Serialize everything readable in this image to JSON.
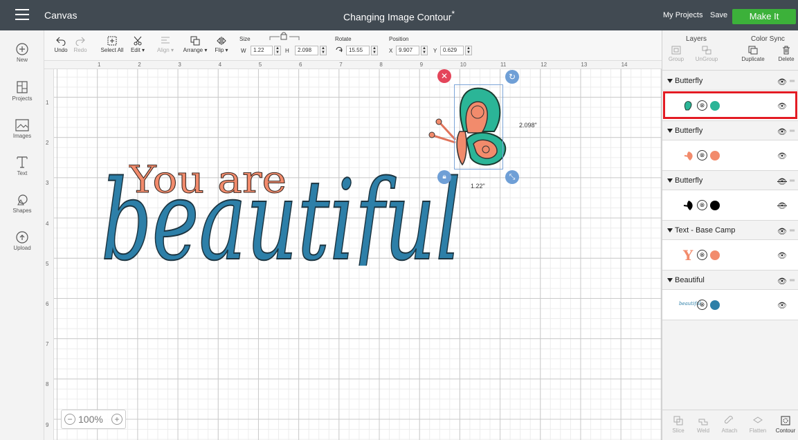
{
  "app": {
    "title": "Canvas",
    "project_title": "Changing Image Contour",
    "modified_mark": "*"
  },
  "header": {
    "my_projects": "My Projects",
    "save": "Save",
    "make_it": "Make It"
  },
  "left_tools": [
    {
      "label": "New",
      "icon": "plus-circle-icon"
    },
    {
      "label": "Projects",
      "icon": "projects-icon"
    },
    {
      "label": "Images",
      "icon": "images-icon"
    },
    {
      "label": "Text",
      "icon": "text-icon"
    },
    {
      "label": "Shapes",
      "icon": "shapes-icon"
    },
    {
      "label": "Upload",
      "icon": "upload-icon"
    }
  ],
  "toolbar": {
    "undo": "Undo",
    "redo": "Redo",
    "select_all": "Select All",
    "edit": "Edit",
    "align": "Align",
    "arrange": "Arrange",
    "flip": "Flip",
    "size_label": "Size",
    "w_label": "W",
    "w_value": "1.22",
    "h_label": "H",
    "h_value": "2.098",
    "rotate_label": "Rotate",
    "rotate_value": "15.55",
    "position_label": "Position",
    "x_label": "X",
    "x_value": "9.907",
    "y_label": "Y",
    "y_value": "0.629"
  },
  "rulers": {
    "horizontal": [
      "1",
      "2",
      "3",
      "4",
      "5",
      "6",
      "7",
      "8",
      "9",
      "10",
      "11",
      "12",
      "13",
      "14"
    ],
    "vertical": [
      "1",
      "2",
      "3",
      "4",
      "5",
      "6",
      "7",
      "8",
      "9"
    ]
  },
  "canvas": {
    "text_small": "You are",
    "text_large": "beautiful",
    "dim_height": "2.098\"",
    "dim_width": "1.22\"",
    "zoom": "100%"
  },
  "layers_panel": {
    "layers_title": "Layers",
    "color_sync_title": "Color Sync",
    "group": "Group",
    "ungroup": "UnGroup",
    "duplicate": "Duplicate",
    "delete": "Delete",
    "groups": [
      {
        "name": "Butterfly",
        "color": "#2bb597",
        "hidden": false,
        "selected": true,
        "thumb": "butterfly-teal"
      },
      {
        "name": "Butterfly",
        "color": "#f28b6c",
        "hidden": false,
        "selected": false,
        "thumb": "butterfly-coral"
      },
      {
        "name": "Butterfly",
        "color": "#000000",
        "hidden": true,
        "selected": false,
        "thumb": "butterfly-black"
      },
      {
        "name": "Text - Base Camp",
        "color": "#f28b6c",
        "hidden": false,
        "selected": false,
        "thumb": "Y"
      },
      {
        "name": "Beautiful",
        "color": "#2d7fa8",
        "hidden": false,
        "selected": false,
        "thumb": "beautiful"
      }
    ],
    "bottom_tools": [
      "Slice",
      "Weld",
      "Attach",
      "Flatten",
      "Contour"
    ]
  },
  "colors": {
    "topbar": "#414a52",
    "make_it": "#3cb13a",
    "teal": "#2bb597",
    "coral": "#f28b6c",
    "blue": "#2d7fa8",
    "selection_red": "#e31b23"
  }
}
